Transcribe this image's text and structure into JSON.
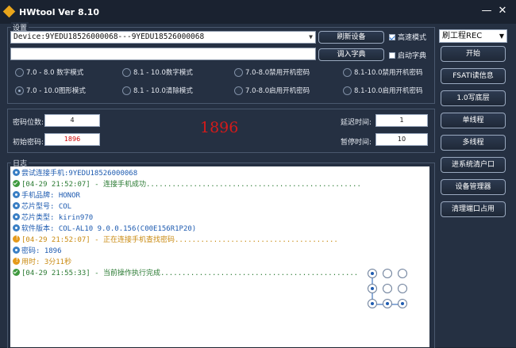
{
  "window": {
    "title": "HWtool Ver 8.10",
    "minimize": "—",
    "close": "✕"
  },
  "settings": {
    "label": "设置",
    "device_combo": "Device:9YEDU18526000068---9YEDU18526000068",
    "path_field": "",
    "refresh_button": "刷新设备",
    "import_dict_button": "调入字典",
    "high_speed_label": "高速模式",
    "high_speed_checked": true,
    "start_dict_label": "启动字典",
    "start_dict_checked": false,
    "modes": [
      {
        "label": "7.0 - 8.0  数字模式",
        "selected": false
      },
      {
        "label": "8.1 - 10.0数字模式",
        "selected": false
      },
      {
        "label": "7.0-8.0禁用开机密码",
        "selected": false
      },
      {
        "label": "8.1-10.0禁用开机密码",
        "selected": false
      },
      {
        "label": "7.0 - 10.0图形模式",
        "selected": true
      },
      {
        "label": "8.1 - 10.0清除模式",
        "selected": false
      },
      {
        "label": "7.0-8.0启用开机密码",
        "selected": false
      },
      {
        "label": "8.1-10.0启用开机密码",
        "selected": false
      }
    ]
  },
  "params": {
    "digits_label": "密码位数:",
    "digits_value": "4",
    "init_label": "初始密码:",
    "init_value": "1896",
    "current_code": "1896",
    "delay_label": "延迟时间:",
    "delay_value": "1",
    "pause_label": "暂停时间:",
    "pause_value": "10"
  },
  "log": {
    "label": "日志",
    "lines": [
      {
        "type": "info",
        "color": "blue",
        "text": "尝试连接手机:9YEDU18526000068"
      },
      {
        "type": "ok",
        "color": "green",
        "text": "[04-29 21:52:07] - 连接手机成功.................................................."
      },
      {
        "type": "info",
        "color": "blue",
        "text": "手机品牌: HONOR"
      },
      {
        "type": "info",
        "color": "blue",
        "text": "芯片型号: COL"
      },
      {
        "type": "info",
        "color": "blue",
        "text": "芯片类型: kirin970"
      },
      {
        "type": "info",
        "color": "blue",
        "text": "软件版本: COL-AL10 9.0.0.156(C00E156R1P20)"
      },
      {
        "type": "warn",
        "color": "orange",
        "text": "[04-29 21:52:07] - 正在连接手机查找密码......................................"
      },
      {
        "type": "info",
        "color": "blue",
        "text": "密码: 1896"
      },
      {
        "type": "warn",
        "color": "orange",
        "text": "用时: 3分11秒"
      },
      {
        "type": "ok",
        "color": "green",
        "text": "[04-29 21:55:33] - 当前操作执行完成.............................................."
      }
    ]
  },
  "sidebar": {
    "mode_select": "刷工程REC",
    "buttons": [
      "开始",
      "FSATI读信息",
      "1.0写底层",
      "单线程",
      "多线程",
      "进系统清户口",
      "设备管理器",
      "清理端口占用"
    ]
  },
  "pattern": {
    "active": [
      true,
      false,
      false,
      true,
      false,
      false,
      true,
      true,
      true
    ]
  }
}
